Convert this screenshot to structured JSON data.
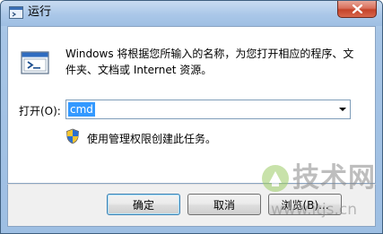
{
  "window": {
    "title": "运行",
    "close_icon": "close-icon",
    "run_icon": "run-program-icon"
  },
  "content": {
    "description": "Windows 将根据您所输入的名称，为您打开相应的程序、文件夹、文档或 Internet 资源。",
    "open_label": "打开(O):",
    "open_value": "cmd",
    "admin_note": "使用管理权限创建此任务。",
    "shield_icon": "uac-shield-icon"
  },
  "buttons": {
    "ok": "确定",
    "cancel": "取消",
    "browse": "浏览(B)..."
  },
  "watermark": {
    "brand": "技术网",
    "url": "www.itjs.cn"
  },
  "colors": {
    "selection": "#3399ff",
    "titlebar": "#aac7e8",
    "close_button": "#c4432a"
  }
}
